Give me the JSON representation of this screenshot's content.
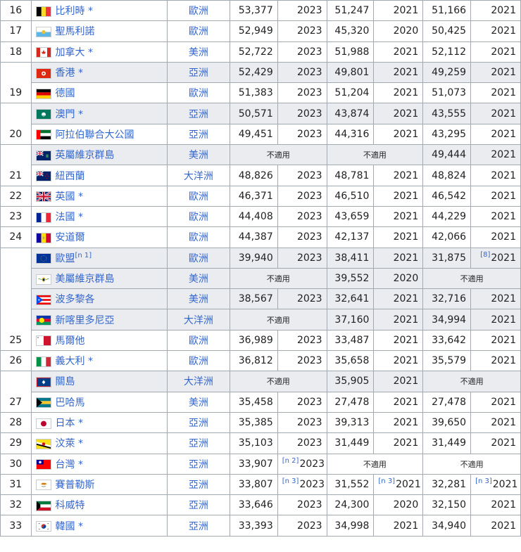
{
  "star": "*",
  "not_applicable": "不適用",
  "rows": [
    {
      "rank": "16",
      "country": "比利時",
      "star": true,
      "flag": "flag-belgium",
      "continent": "歐洲",
      "imf": "53,377",
      "imf_year": "2023",
      "wb": "51,247",
      "wb_year": "2021",
      "cia": "51,166",
      "cia_year": "2021"
    },
    {
      "rank": "17",
      "country": "聖馬利諾",
      "star": false,
      "flag": "flag-san-marino",
      "continent": "歐洲",
      "imf": "52,949",
      "imf_year": "2023",
      "wb": "45,320",
      "wb_year": "2020",
      "cia": "50,425",
      "cia_year": "2021"
    },
    {
      "rank": "18",
      "country": "加拿大",
      "star": true,
      "flag": "flag-canada",
      "continent": "美洲",
      "imf": "52,722",
      "imf_year": "2023",
      "wb": "51,988",
      "wb_year": "2021",
      "cia": "52,112",
      "cia_year": "2021"
    },
    {
      "rank": "",
      "country": "香港",
      "star": true,
      "flag": "flag-hong-kong",
      "continent": "亞洲",
      "imf": "52,429",
      "imf_year": "2023",
      "wb": "49,801",
      "wb_year": "2021",
      "cia": "49,259",
      "cia_year": "2021"
    },
    {
      "rank": "19",
      "country": "德國",
      "star": false,
      "flag": "flag-germany",
      "continent": "歐洲",
      "imf": "51,383",
      "imf_year": "2023",
      "wb": "51,204",
      "wb_year": "2021",
      "cia": "51,073",
      "cia_year": "2021"
    },
    {
      "rank": "",
      "country": "澳門",
      "star": true,
      "flag": "flag-macau",
      "continent": "亞洲",
      "imf": "50,571",
      "imf_year": "2023",
      "wb": "43,874",
      "wb_year": "2021",
      "cia": "43,555",
      "cia_year": "2021"
    },
    {
      "rank": "20",
      "country": "阿拉伯聯合大公國",
      "star": false,
      "flag": "flag-uae",
      "continent": "亞洲",
      "imf": "49,451",
      "imf_year": "2023",
      "wb": "44,316",
      "wb_year": "2021",
      "cia": "43,295",
      "cia_year": "2021"
    },
    {
      "rank": "",
      "country": "英屬維京群島",
      "star": false,
      "flag": "flag-bvi",
      "continent": "美洲",
      "imf": null,
      "imf_year": null,
      "wb": null,
      "wb_year": null,
      "cia": "49,444",
      "cia_year": "2021"
    },
    {
      "rank": "21",
      "country": "紐西蘭",
      "star": false,
      "flag": "flag-new-zealand",
      "continent": "大洋洲",
      "imf": "48,826",
      "imf_year": "2023",
      "wb": "48,781",
      "wb_year": "2021",
      "cia": "48,824",
      "cia_year": "2021"
    },
    {
      "rank": "22",
      "country": "英國",
      "star": true,
      "flag": "flag-uk",
      "continent": "歐洲",
      "imf": "46,371",
      "imf_year": "2023",
      "wb": "46,510",
      "wb_year": "2021",
      "cia": "46,542",
      "cia_year": "2021"
    },
    {
      "rank": "23",
      "country": "法國",
      "star": true,
      "flag": "flag-france",
      "continent": "歐洲",
      "imf": "44,408",
      "imf_year": "2023",
      "wb": "43,659",
      "wb_year": "2021",
      "cia": "44,229",
      "cia_year": "2021"
    },
    {
      "rank": "24",
      "country": "安道爾",
      "star": false,
      "flag": "flag-andorra",
      "continent": "歐洲",
      "imf": "44,387",
      "imf_year": "2023",
      "wb": "42,137",
      "wb_year": "2021",
      "cia": "42,066",
      "cia_year": "2021"
    },
    {
      "rank": "",
      "country": "歐盟",
      "star": false,
      "country_note": "[n 1]",
      "flag": "flag-eu",
      "continent": "歐洲",
      "imf": "39,940",
      "imf_year": "2023",
      "wb": "38,411",
      "wb_year": "2021",
      "cia": "31,875",
      "cia_note": "[8]",
      "cia_year": "2021"
    },
    {
      "rank": "",
      "country": "美屬維京群島",
      "star": false,
      "flag": "flag-usvi",
      "continent": "美洲",
      "imf": null,
      "imf_year": null,
      "wb": "39,552",
      "wb_year": "2020",
      "cia": null,
      "cia_year": null
    },
    {
      "rank": "",
      "country": "波多黎各",
      "star": false,
      "flag": "flag-puerto-rico",
      "continent": "美洲",
      "imf": "38,567",
      "imf_year": "2023",
      "wb": "32,641",
      "wb_year": "2021",
      "cia": "32,716",
      "cia_year": "2021"
    },
    {
      "rank": "",
      "country": "新喀里多尼亞",
      "star": false,
      "flag": "flag-new-caledonia",
      "continent": "大洋洲",
      "imf": null,
      "imf_year": null,
      "wb": "37,160",
      "wb_year": "2021",
      "cia": "34,994",
      "cia_year": "2021"
    },
    {
      "rank": "25",
      "country": "馬爾他",
      "star": false,
      "flag": "flag-malta",
      "continent": "歐洲",
      "imf": "36,989",
      "imf_year": "2023",
      "wb": "33,487",
      "wb_year": "2021",
      "cia": "33,642",
      "cia_year": "2021"
    },
    {
      "rank": "26",
      "country": "義大利",
      "star": true,
      "flag": "flag-italy",
      "continent": "歐洲",
      "imf": "36,812",
      "imf_year": "2023",
      "wb": "35,658",
      "wb_year": "2021",
      "cia": "35,579",
      "cia_year": "2021"
    },
    {
      "rank": "",
      "country": "關島",
      "star": false,
      "flag": "flag-guam",
      "continent": "大洋洲",
      "imf": null,
      "imf_year": null,
      "wb": "35,905",
      "wb_year": "2021",
      "cia": null,
      "cia_year": null
    },
    {
      "rank": "27",
      "country": "巴哈馬",
      "star": false,
      "flag": "flag-bahamas",
      "continent": "美洲",
      "imf": "35,458",
      "imf_year": "2023",
      "wb": "27,478",
      "wb_year": "2021",
      "cia": "27,478",
      "cia_year": "2021"
    },
    {
      "rank": "28",
      "country": "日本",
      "star": true,
      "flag": "flag-japan",
      "continent": "亞洲",
      "imf": "35,385",
      "imf_year": "2023",
      "wb": "39,313",
      "wb_year": "2021",
      "cia": "39,650",
      "cia_year": "2021"
    },
    {
      "rank": "29",
      "country": "汶萊",
      "star": true,
      "flag": "flag-brunei",
      "continent": "亞洲",
      "imf": "35,103",
      "imf_year": "2023",
      "wb": "31,449",
      "wb_year": "2021",
      "cia": "31,449",
      "cia_year": "2021"
    },
    {
      "rank": "30",
      "country": "台灣",
      "star": true,
      "flag": "flag-taiwan",
      "continent": "亞洲",
      "imf": "33,907",
      "imf_note": "[n 2]",
      "imf_year": "2023",
      "wb": null,
      "wb_year": null,
      "cia": null,
      "cia_year": null
    },
    {
      "rank": "31",
      "country": "賽普勒斯",
      "star": false,
      "flag": "flag-cyprus",
      "continent": "亞洲",
      "imf": "33,807",
      "imf_note": "[n 3]",
      "imf_year": "2023",
      "wb": "31,552",
      "wb_note": "[n 3]",
      "wb_year": "2021",
      "cia": "32,281",
      "cia_note": "[n 3]",
      "cia_year": "2021"
    },
    {
      "rank": "32",
      "country": "科威特",
      "star": false,
      "flag": "flag-kuwait",
      "continent": "亞洲",
      "imf": "33,646",
      "imf_year": "2023",
      "wb": "24,300",
      "wb_year": "2020",
      "cia": "32,150",
      "cia_year": "2021"
    },
    {
      "rank": "33",
      "country": "韓國",
      "star": true,
      "flag": "flag-south-korea",
      "continent": "亞洲",
      "imf": "33,393",
      "imf_year": "2023",
      "wb": "34,998",
      "wb_year": "2021",
      "cia": "34,940",
      "cia_year": "2021"
    }
  ]
}
